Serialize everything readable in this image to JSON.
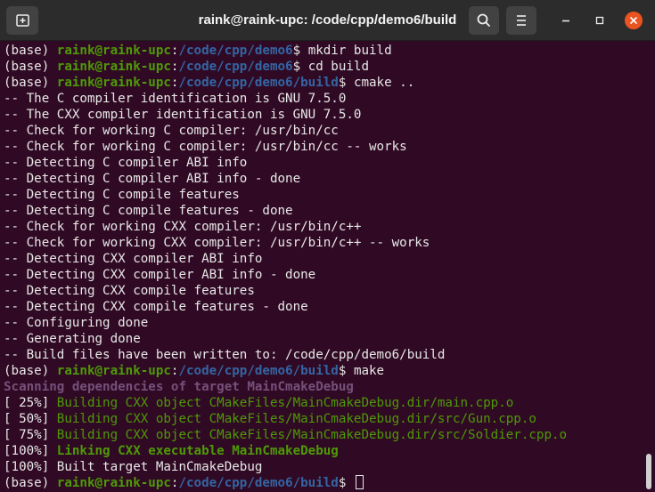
{
  "window": {
    "title": "raink@raink-upc: /code/cpp/demo6/build",
    "colors": {
      "background": "#300a24",
      "titlebar": "#2c2c2c",
      "close": "#e95420",
      "prompt_user": "#4e9a06",
      "prompt_path": "#3465a4",
      "cmake_scan": "#75507b"
    },
    "buttons": {
      "new_tab": "new-tab-icon",
      "search": "search-icon",
      "menu": "hamburger-menu-icon",
      "minimize": "minimize-icon",
      "maximize": "maximize-icon",
      "close": "close-icon"
    }
  },
  "terminal": {
    "lines": [
      {
        "kind": "prompt",
        "env": "(base) ",
        "user": "raink@raink-upc",
        "colon": ":",
        "path": "/code/cpp/demo6",
        "sign": "$ ",
        "cmd": "mkdir build"
      },
      {
        "kind": "prompt",
        "env": "(base) ",
        "user": "raink@raink-upc",
        "colon": ":",
        "path": "/code/cpp/demo6",
        "sign": "$ ",
        "cmd": "cd build"
      },
      {
        "kind": "prompt",
        "env": "(base) ",
        "user": "raink@raink-upc",
        "colon": ":",
        "path": "/code/cpp/demo6/build",
        "sign": "$ ",
        "cmd": "cmake .."
      },
      {
        "kind": "text",
        "text": "-- The C compiler identification is GNU 7.5.0"
      },
      {
        "kind": "text",
        "text": "-- The CXX compiler identification is GNU 7.5.0"
      },
      {
        "kind": "text",
        "text": "-- Check for working C compiler: /usr/bin/cc"
      },
      {
        "kind": "text",
        "text": "-- Check for working C compiler: /usr/bin/cc -- works"
      },
      {
        "kind": "text",
        "text": "-- Detecting C compiler ABI info"
      },
      {
        "kind": "text",
        "text": "-- Detecting C compiler ABI info - done"
      },
      {
        "kind": "text",
        "text": "-- Detecting C compile features"
      },
      {
        "kind": "text",
        "text": "-- Detecting C compile features - done"
      },
      {
        "kind": "text",
        "text": "-- Check for working CXX compiler: /usr/bin/c++"
      },
      {
        "kind": "text",
        "text": "-- Check for working CXX compiler: /usr/bin/c++ -- works"
      },
      {
        "kind": "text",
        "text": "-- Detecting CXX compiler ABI info"
      },
      {
        "kind": "text",
        "text": "-- Detecting CXX compiler ABI info - done"
      },
      {
        "kind": "text",
        "text": "-- Detecting CXX compile features"
      },
      {
        "kind": "text",
        "text": "-- Detecting CXX compile features - done"
      },
      {
        "kind": "text",
        "text": "-- Configuring done"
      },
      {
        "kind": "text",
        "text": "-- Generating done"
      },
      {
        "kind": "text",
        "text": "-- Build files have been written to: /code/cpp/demo6/build"
      },
      {
        "kind": "prompt",
        "env": "(base) ",
        "user": "raink@raink-upc",
        "colon": ":",
        "path": "/code/cpp/demo6/build",
        "sign": "$ ",
        "cmd": "make"
      },
      {
        "kind": "scan",
        "text": "Scanning dependencies of target MainCmakeDebug"
      },
      {
        "kind": "build",
        "pct": "[ 25%] ",
        "text": "Building CXX object CMakeFiles/MainCmakeDebug.dir/main.cpp.o"
      },
      {
        "kind": "build",
        "pct": "[ 50%] ",
        "text": "Building CXX object CMakeFiles/MainCmakeDebug.dir/src/Gun.cpp.o"
      },
      {
        "kind": "build",
        "pct": "[ 75%] ",
        "text": "Building CXX object CMakeFiles/MainCmakeDebug.dir/src/Soldier.cpp.o"
      },
      {
        "kind": "link",
        "pct": "[100%] ",
        "text": "Linking CXX executable MainCmakeDebug"
      },
      {
        "kind": "plain",
        "pct": "[100%] ",
        "text": "Built target MainCmakeDebug"
      },
      {
        "kind": "prompt_cursor",
        "env": "(base) ",
        "user": "raink@raink-upc",
        "colon": ":",
        "path": "/code/cpp/demo6/build",
        "sign": "$ ",
        "cmd": ""
      }
    ]
  }
}
